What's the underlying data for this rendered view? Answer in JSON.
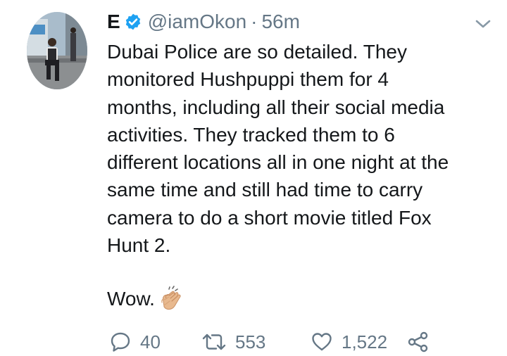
{
  "tweet": {
    "display_name": "E",
    "handle": "@iamOkon",
    "separator": "·",
    "time": "56m",
    "text_lines": [
      "Dubai Police are so detailed. They",
      "monitored Hushpuppi them for 4",
      "months, including all their social media",
      "activities. They tracked them to 6",
      "different locations all in one night at the",
      "same time and still had time to carry",
      "camera to do a short movie titled Fox",
      "Hunt 2."
    ],
    "wow": "Wow.",
    "emoji": "clapping-hands-icon",
    "replies": "40",
    "retweets": "553",
    "likes": "1,522"
  },
  "icons": {
    "verified": "verified-badge-icon",
    "menu": "chevron-down-icon",
    "reply": "reply-icon",
    "retweet": "retweet-icon",
    "like": "heart-icon",
    "share": "share-icon"
  },
  "colors": {
    "text": "#14171a",
    "secondary": "#657786",
    "verified": "#1da1f2"
  }
}
